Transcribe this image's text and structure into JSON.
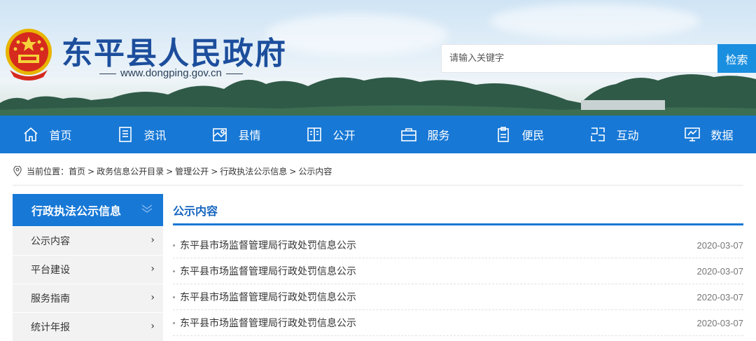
{
  "header": {
    "site_title": "东平县人民政府",
    "site_url": "www.dongping.gov.cn",
    "emblem_icon": "national-emblem-icon"
  },
  "search": {
    "placeholder": "请输入关键字",
    "button_label": "检索"
  },
  "nav": {
    "items": [
      {
        "label": "首页",
        "icon": "home-icon"
      },
      {
        "label": "资讯",
        "icon": "news-icon"
      },
      {
        "label": "县情",
        "icon": "map-icon"
      },
      {
        "label": "公开",
        "icon": "book-icon"
      },
      {
        "label": "服务",
        "icon": "briefcase-icon"
      },
      {
        "label": "便民",
        "icon": "clipboard-icon"
      },
      {
        "label": "互动",
        "icon": "interact-icon"
      },
      {
        "label": "数据",
        "icon": "chart-monitor-icon"
      }
    ],
    "color": "#1778d6"
  },
  "breadcrumb": {
    "prefix": "当前位置：",
    "items": [
      "首页",
      "政务信息公开目录",
      "管理公开",
      "行政执法公示信息",
      "公示内容"
    ],
    "separator": ">"
  },
  "sidebar": {
    "title": "行政执法公示信息",
    "items": [
      "公示内容",
      "平台建设",
      "服务指南",
      "统计年报"
    ],
    "arrow": "›"
  },
  "main": {
    "title": "公示内容",
    "rows": [
      {
        "title": "东平县市场监督管理局行政处罚信息公示",
        "date": "2020-03-07"
      },
      {
        "title": "东平县市场监督管理局行政处罚信息公示",
        "date": "2020-03-07"
      },
      {
        "title": "东平县市场监督管理局行政处罚信息公示",
        "date": "2020-03-07"
      },
      {
        "title": "东平县市场监督管理局行政处罚信息公示",
        "date": "2020-03-07"
      }
    ]
  }
}
